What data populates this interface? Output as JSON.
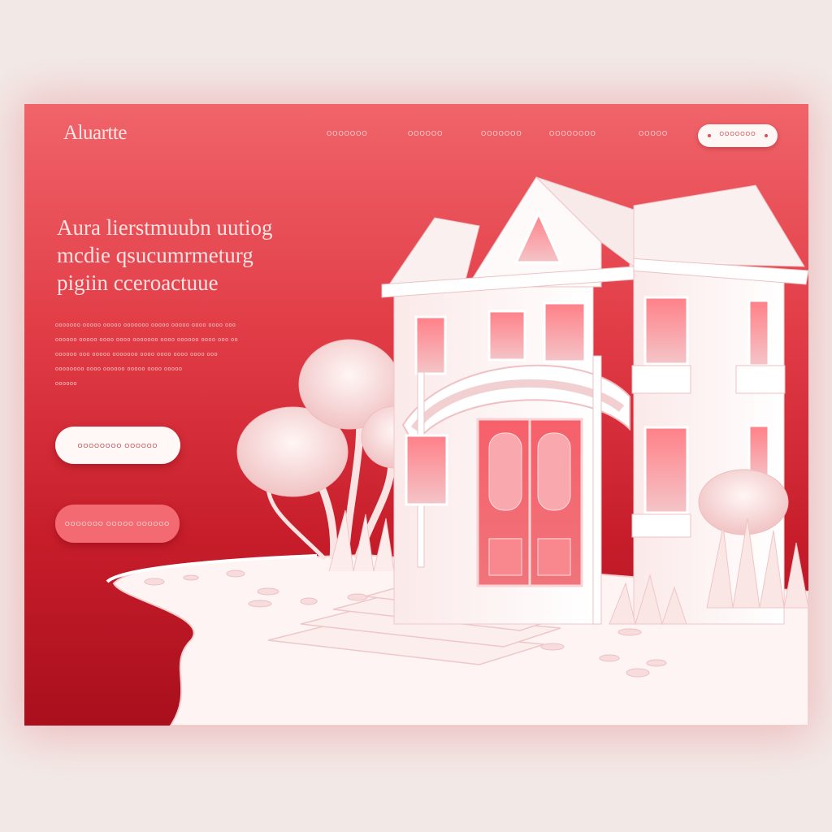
{
  "header": {
    "logo": "Aluartte",
    "nav": [
      "OOOOOOO",
      "OOOOOO",
      "OOOOOOO",
      "OOOOOOOO",
      "OOOOO"
    ],
    "cta_label": "OOOOOOO"
  },
  "hero": {
    "headline_lines": [
      "Aura lierstmuubn uutiog",
      "mcdie qsucumrmeturg",
      "pigiin cceroactuue"
    ],
    "paragraph_lines": [
      "ooooooo ooooo ooooo ooooooo ooooo ooooo oooo oooo ooo",
      "oooooo ooooo oooo oooo ooooooo oooo oooooo oooo ooo oo",
      "oooooo ooo ooooo ooooooo oooo oooo oooo oooo ooo",
      "oooooooo oooo oooooo ooooo oooo ooooo",
      "oooooo"
    ],
    "primary_button": "OOOOOOOO   OOOOOO",
    "secondary_button": "OOOOOOO OOOOO OOOOOO"
  },
  "colors": {
    "accent": "#e23e48",
    "accent_dark": "#a90f1c",
    "light": "#fff8f6",
    "pink_button": "#f46a72"
  },
  "illustration": {
    "subject": "white-paper-house-with-trees",
    "icon_names": [
      "house-illustration",
      "tree-illustration",
      "bush-illustration",
      "path-illustration"
    ]
  }
}
